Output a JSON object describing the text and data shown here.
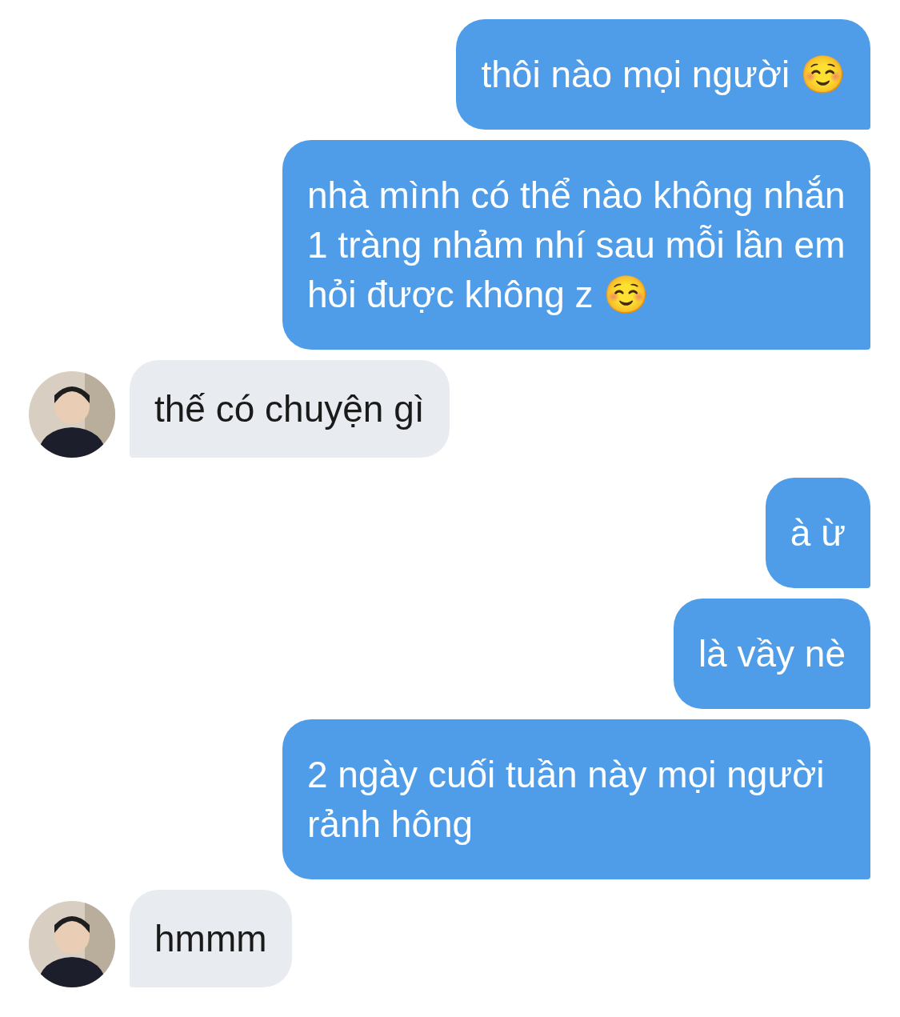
{
  "messages": [
    {
      "kind": "sent",
      "text": "thôi nào mọi người ☺️"
    },
    {
      "kind": "sent",
      "text": "nhà mình có thể nào không nhắn 1 tràng nhảm nhí sau mỗi lần em hỏi được không z ☺️"
    },
    {
      "kind": "received",
      "text": "thế có chuyện gì"
    },
    {
      "kind": "sent",
      "text": "à ừ"
    },
    {
      "kind": "sent",
      "text": "là vầy nè"
    },
    {
      "kind": "sent",
      "text": "2 ngày cuối tuần này mọi người rảnh hông"
    },
    {
      "kind": "received",
      "text": "hmmm"
    }
  ]
}
